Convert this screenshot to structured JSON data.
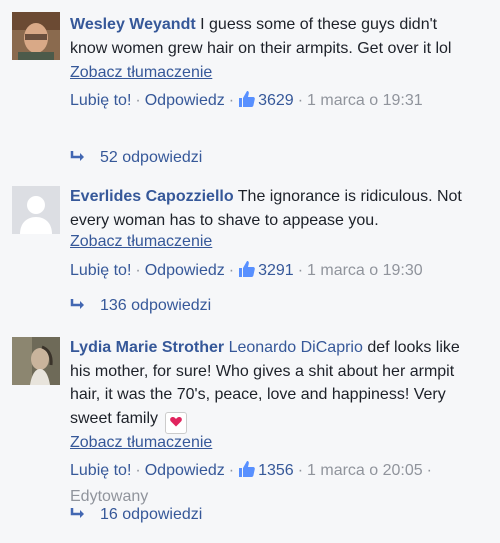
{
  "colors": {
    "link": "#365899",
    "muted": "#90949c",
    "text": "#1d2129",
    "heart": "#e0245e"
  },
  "comments": [
    {
      "author": "Wesley Weyandt",
      "text": " I guess some of these guys didn't know women grew hair on their armpits. Get over it lol",
      "see_translation": "Zobacz tłumaczenie",
      "like_label": "Lubię to!",
      "reply_label": "Odpowiedz",
      "likes": "3629",
      "timestamp": "1 marca o 19:31",
      "replies": "52 odpowiedzi"
    },
    {
      "author": "Everlides Capozziello",
      "text": " The ignorance is ridiculous. Not every woman has to shave to appease you.",
      "see_translation": "Zobacz tłumaczenie",
      "like_label": "Lubię to!",
      "reply_label": "Odpowiedz",
      "likes": "3291",
      "timestamp": "1 marca o 19:30",
      "replies": "136 odpowiedzi"
    },
    {
      "author": "Lydia Marie Strother",
      "mention": "Leonardo DiCaprio",
      "text": " def looks like his mother, for sure! Who gives a shit about her armpit hair, it was the 70's, peace, love and happiness! Very sweet family ",
      "emoji": "heart-icon",
      "see_translation": "Zobacz tłumaczenie",
      "like_label": "Lubię to!",
      "reply_label": "Odpowiedz",
      "likes": "1356",
      "timestamp": "1 marca o 20:05",
      "edited": "Edytowany",
      "replies": "16 odpowiedzi"
    }
  ]
}
